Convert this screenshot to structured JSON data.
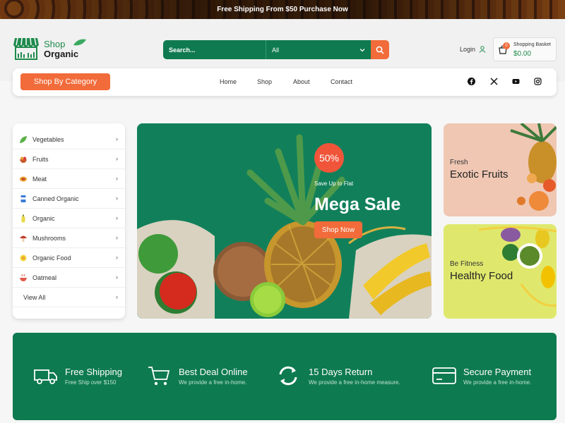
{
  "topbar": {
    "text": "Free Shipping From $50 Purchase Now"
  },
  "logo": {
    "line1": "Shop",
    "line2": "Organic"
  },
  "search": {
    "placeholder": "Search...",
    "category": "All"
  },
  "header": {
    "login": "Login",
    "basket_title": "Shopping Basket",
    "basket_total": "$0.00",
    "basket_count": "0"
  },
  "nav": {
    "category_button": "Shop By Category",
    "links": [
      "Home",
      "Shop",
      "About",
      "Contact"
    ],
    "social": [
      "facebook-icon",
      "x-icon",
      "youtube-icon",
      "instagram-icon"
    ]
  },
  "categories": {
    "items": [
      {
        "label": "Vegetables",
        "icon": "leaf-icon"
      },
      {
        "label": "Fruits",
        "icon": "fruit-bowl-icon"
      },
      {
        "label": "Meat",
        "icon": "meat-icon"
      },
      {
        "label": "Canned Organic",
        "icon": "can-icon"
      },
      {
        "label": "Organic",
        "icon": "bottle-icon"
      },
      {
        "label": "Mushrooms",
        "icon": "mushroom-icon"
      },
      {
        "label": "Organic Food",
        "icon": "food-icon"
      },
      {
        "label": "Oatmeal",
        "icon": "oatmeal-icon"
      }
    ],
    "view_all": "View All"
  },
  "hero": {
    "badge": "50%",
    "subtitle": "Save Up to Flat",
    "title": "Mega Sale",
    "button": "Shop Now"
  },
  "promos": [
    {
      "sub": "Fresh",
      "title": "Exotic Fruits"
    },
    {
      "sub": "Be Fitness",
      "title": "Healthy Food"
    }
  ],
  "features": [
    {
      "title": "Free Shipping",
      "desc": "Free Ship over $150",
      "icon": "truck-icon"
    },
    {
      "title": "Best Deal Online",
      "desc": "We provide a free in-home.",
      "icon": "cart-icon"
    },
    {
      "title": "15 Days Return",
      "desc": "We provide a free in-home measure.",
      "icon": "return-icon"
    },
    {
      "title": "Secure Payment",
      "desc": "We provide a free in-home.",
      "icon": "card-icon"
    }
  ],
  "colors": {
    "primary_green": "#0e7a50",
    "accent_orange": "#f26b3a"
  }
}
